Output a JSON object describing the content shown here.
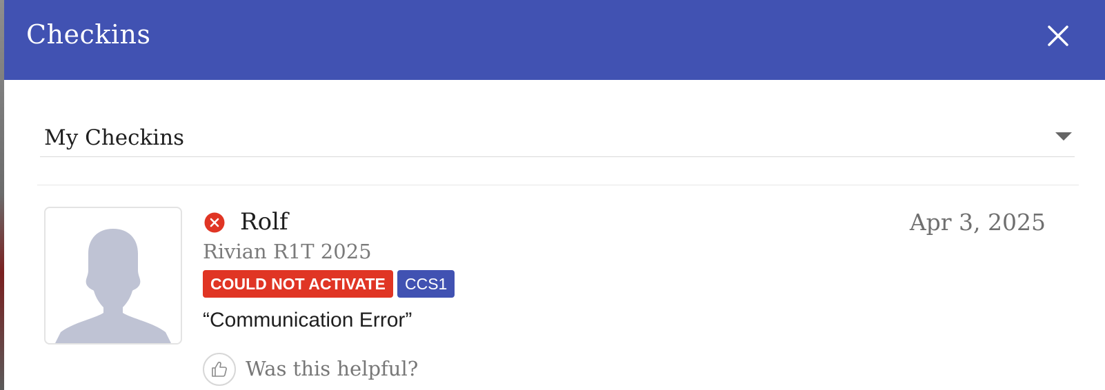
{
  "header": {
    "title": "Checkins"
  },
  "filter": {
    "selected": "My Checkins"
  },
  "checkin": {
    "user_name": "Rolf",
    "date": "Apr 3, 2025",
    "vehicle": "Rivian R1T 2025",
    "status_badge": "COULD NOT ACTIVATE",
    "connector_badge": "CCS1",
    "comment": "“Communication Error”",
    "helpful_prompt": "Was this helpful?"
  },
  "icons": {
    "close": "close-icon",
    "dropdown": "chevron-down-icon",
    "status": "error-circle-icon",
    "avatar": "default-avatar-icon",
    "helpful": "thumbs-up-icon"
  },
  "colors": {
    "header_bg": "#4152b2",
    "status_red": "#e03524",
    "connector_blue": "#4152b2"
  }
}
